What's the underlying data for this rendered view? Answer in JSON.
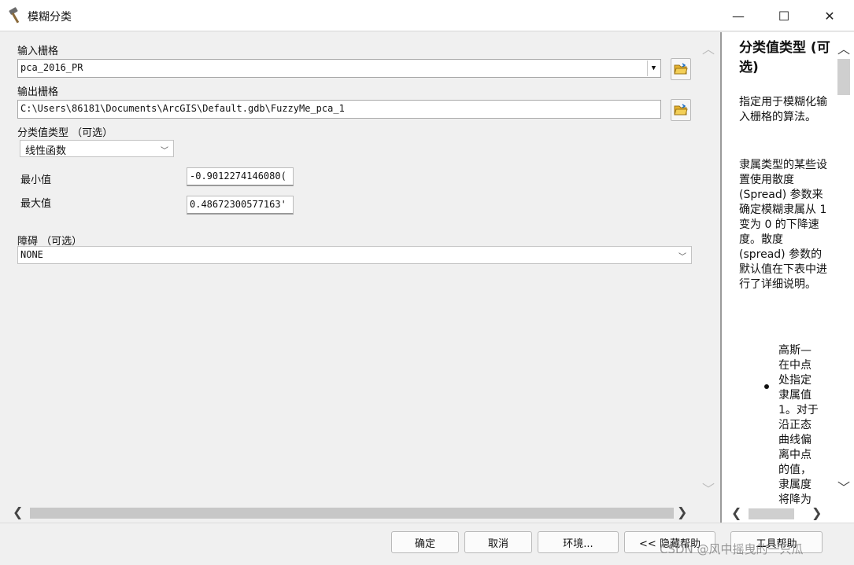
{
  "window": {
    "title": "模糊分类",
    "minimize_glyph": "—",
    "maximize_glyph": "☐",
    "close_glyph": "✕"
  },
  "form": {
    "input_raster": {
      "label": "输入栅格",
      "value": "pca_2016_PR"
    },
    "output_raster": {
      "label": "输出栅格",
      "value": "C:\\Users\\86181\\Documents\\ArcGIS\\Default.gdb\\FuzzyMe_pca_1"
    },
    "class_type": {
      "label": "分类值类型 （可选）",
      "value": "线性函数"
    },
    "minimum": {
      "label": "最小值",
      "value": "-0.9012274146080("
    },
    "maximum": {
      "label": "最大值",
      "value": "0.48672300577163'"
    },
    "barrier": {
      "label": "障碍 （可选）",
      "value": "NONE"
    }
  },
  "help": {
    "title": "分类值类型 (可选)",
    "para1": "指定用于模糊化输入栅格的算法。",
    "para2": "隶属类型的某些设置使用散度 (Spread) 参数来确定模糊隶属从 1 变为 0 的下降速度。散度 (spread) 参数的默认值在下表中进行了详细说明。",
    "bullet1": "高斯—在中点处指定隶属值 1。对于沿正态曲线偏离中点的值，隶属度将降为"
  },
  "buttons": {
    "ok": "确定",
    "cancel": "取消",
    "environments": "环境...",
    "hide_help": "<< 隐藏帮助",
    "tool_help": "工具帮助"
  },
  "watermark": "CSDN @风中摇曳的一只瓜",
  "colors": {
    "title_bg": "#ffffff",
    "panel_bg": "#f0f0f0",
    "help_bg": "#ffffff",
    "scroll_thumb": "#c7c7c7"
  }
}
